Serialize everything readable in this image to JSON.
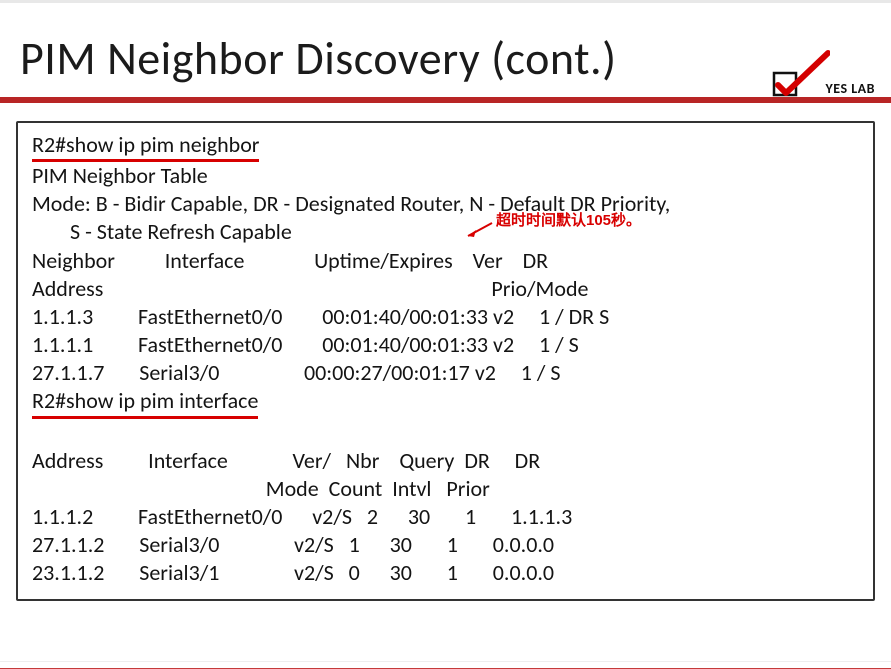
{
  "slide": {
    "title": "PIM Neighbor Discovery (cont.)",
    "logo_text": "YES LAB"
  },
  "commands": {
    "cmd1": "R2#show ip pim neighbor",
    "cmd2": "R2#show ip pim interface"
  },
  "neighbor_section": {
    "table_title": "PIM Neighbor Table",
    "mode_line": "Mode: B - Bidir Capable, DR - Designated Router, N - Default DR Priority,",
    "mode_line2": "S - State Refresh Capable",
    "hdr_neighbor": "Neighbor",
    "hdr_interface": "Interface",
    "hdr_uptime_expires": "Uptime/Expires",
    "hdr_ver": "Ver",
    "hdr_dr": "DR",
    "hdr_address": "Address",
    "hdr_prio_mode": "Prio/Mode",
    "rows": [
      {
        "addr": "1.1.1.3",
        "iface": "FastEthernet0/0",
        "upexp": "00:01:40/00:01:33",
        "ver": "v2",
        "drpm": "1 / DR S"
      },
      {
        "addr": "1.1.1.1",
        "iface": "FastEthernet0/0",
        "upexp": "00:01:40/00:01:33",
        "ver": "v2",
        "drpm": "1 / S"
      },
      {
        "addr": "27.1.1.7",
        "iface": "Serial3/0",
        "upexp": "00:00:27/00:01:17",
        "ver": "v2",
        "drpm": "1 / S"
      }
    ]
  },
  "interface_section": {
    "hdr_address": "Address",
    "hdr_interface": "Interface",
    "hdr_ver": "Ver/",
    "hdr_nbr": "Nbr",
    "hdr_query": "Query",
    "hdr_dr1": "DR",
    "hdr_dr2": "DR",
    "hdr_mode": "Mode",
    "hdr_count": "Count",
    "hdr_intvl": "Intvl",
    "hdr_prior": "Prior",
    "rows": [
      {
        "addr": "1.1.1.2",
        "iface": "FastEthernet0/0",
        "vermode": "v2/S",
        "nbr": "2",
        "qintvl": "30",
        "drprior": "1",
        "dr": "1.1.1.3"
      },
      {
        "addr": "27.1.1.2",
        "iface": "Serial3/0",
        "vermode": "v2/S",
        "nbr": "1",
        "qintvl": "30",
        "drprior": "1",
        "dr": "0.0.0.0"
      },
      {
        "addr": "23.1.1.2",
        "iface": "Serial3/1",
        "vermode": "v2/S",
        "nbr": "0",
        "qintvl": "30",
        "drprior": "1",
        "dr": "0.0.0.0"
      }
    ]
  },
  "annotation": {
    "text": "超时时间默认105秒。"
  }
}
